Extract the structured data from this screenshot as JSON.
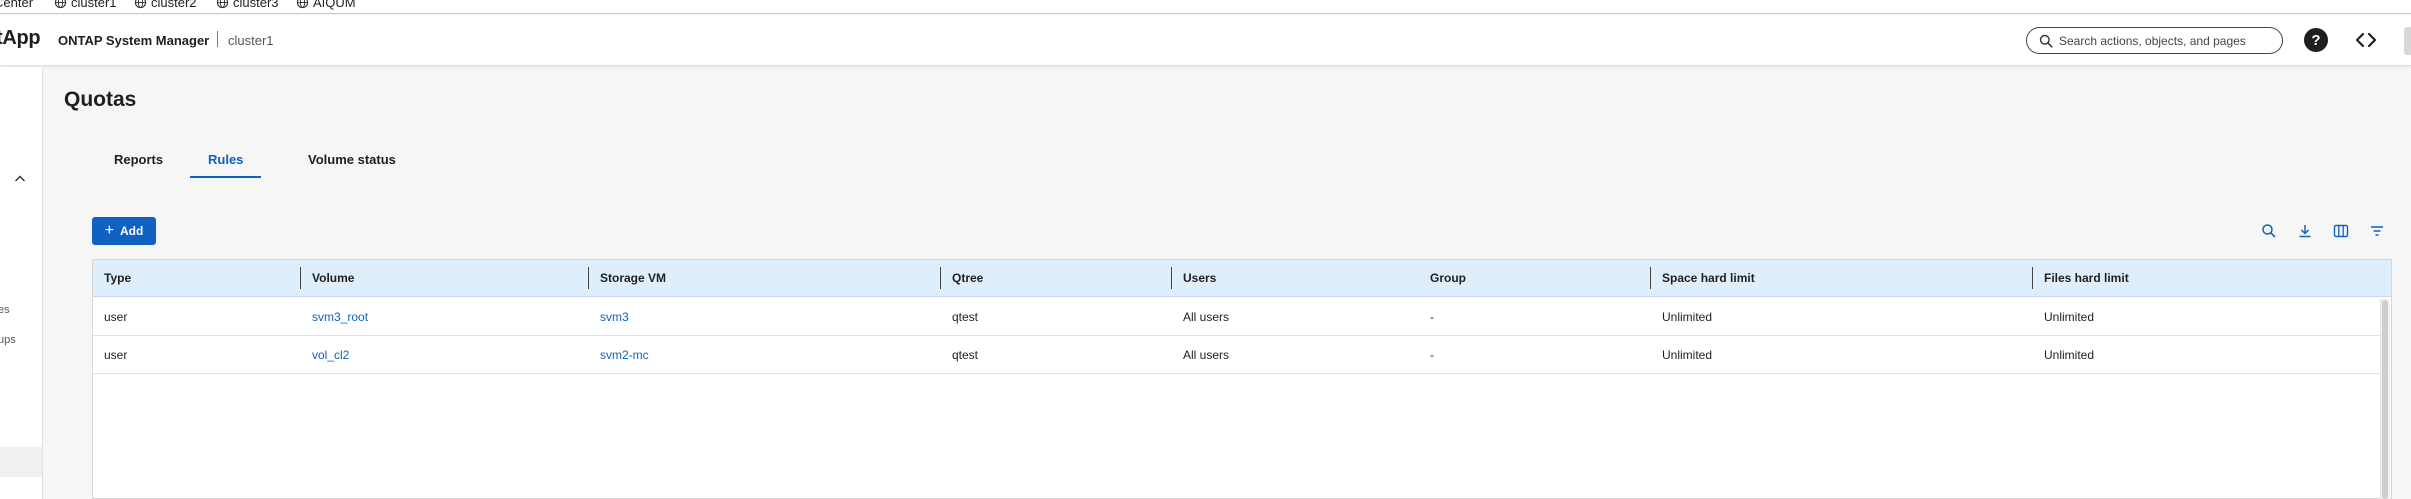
{
  "bookmarks": [
    {
      "label": "Center"
    },
    {
      "label": "cluster1"
    },
    {
      "label": "cluster2"
    },
    {
      "label": "cluster3"
    },
    {
      "label": "AIQUM"
    }
  ],
  "header": {
    "logo": "tApp",
    "app_name": "ONTAP System Manager",
    "cluster": "cluster1",
    "search_placeholder": "Search actions, objects, and pages",
    "help_label": "?"
  },
  "leftnav": {
    "fragments": [
      "es",
      "ups"
    ]
  },
  "page": {
    "title": "Quotas",
    "tabs": [
      {
        "label": "Reports",
        "active": false
      },
      {
        "label": "Rules",
        "active": true
      },
      {
        "label": "Volume status",
        "active": false
      }
    ],
    "add_label": "Add"
  },
  "table": {
    "columns": [
      "Type",
      "Volume",
      "Storage VM",
      "Qtree",
      "Users",
      "Group",
      "Space hard limit",
      "Files hard limit"
    ],
    "rows": [
      {
        "type": "user",
        "volume": "svm3_root",
        "storage_vm": "svm3",
        "qtree": "qtest",
        "users": "All users",
        "group": "-",
        "space_hard_limit": "Unlimited",
        "files_hard_limit": "Unlimited"
      },
      {
        "type": "user",
        "volume": "vol_cl2",
        "storage_vm": "svm2-mc",
        "qtree": "qtest",
        "users": "All users",
        "group": "-",
        "space_hard_limit": "Unlimited",
        "files_hard_limit": "Unlimited"
      }
    ]
  },
  "icons": {
    "globe": "globe-icon",
    "search": "search-icon",
    "help": "help-icon",
    "code": "code-icon",
    "download": "download-icon",
    "columns": "columns-icon",
    "filter": "filter-icon",
    "chevron": "chevron-up-icon"
  },
  "colors": {
    "accent": "#0f62c2",
    "header_row": "#dfeefb",
    "background": "#f6f6f6"
  }
}
